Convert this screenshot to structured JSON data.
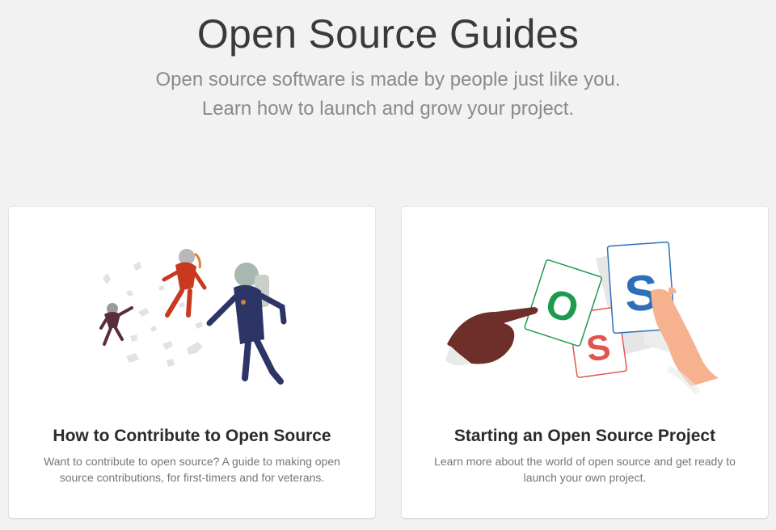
{
  "hero": {
    "title": "Open Source Guides",
    "subtitle_line1": "Open source software is made by people just like you.",
    "subtitle_line2": "Learn how to launch and grow your project."
  },
  "cards": [
    {
      "title": "How to Contribute to Open Source",
      "description": "Want to contribute to open source? A guide to making open source contributions, for first-timers and for veterans.",
      "illustration": "floating-astronauts-illustration"
    },
    {
      "title": "Starting an Open Source Project",
      "description": "Learn more about the world of open source and get ready to launch your own project.",
      "illustration": "oss-letter-cards-illustration",
      "card_letters": [
        "O",
        "S",
        "S"
      ]
    }
  ],
  "colors": {
    "background": "#f2f2f2",
    "card": "#ffffff",
    "title": "#3a3a3a",
    "subtitle": "#8a8a8a",
    "letter_o": "#1e9a4e",
    "letter_s_red": "#e0564f",
    "letter_s_blue": "#2f6fba"
  }
}
